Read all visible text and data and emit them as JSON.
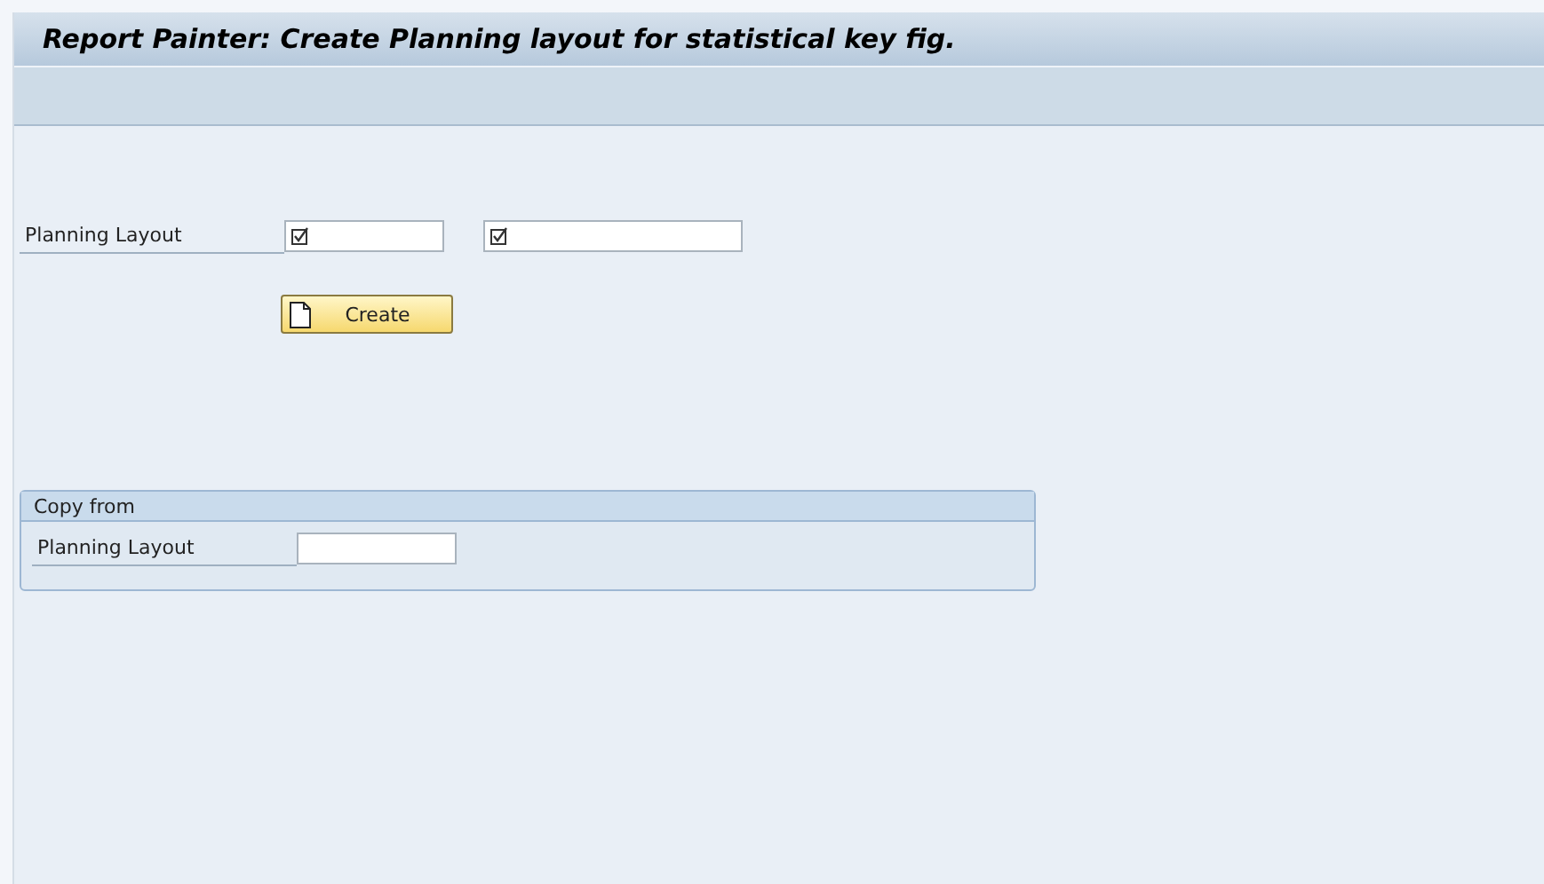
{
  "window": {
    "title": "Report Painter: Create Planning layout for statistical key fig."
  },
  "fields": [
    {
      "label": "Planning Layout",
      "inputs": [
        {
          "required": true
        },
        {
          "required": true
        }
      ]
    }
  ],
  "button": {
    "label": "Create"
  },
  "group": {
    "title": "Copy from",
    "fields": [
      {
        "label": "Planning Layout",
        "inputs": [
          {
            "required": false
          }
        ]
      }
    ]
  }
}
